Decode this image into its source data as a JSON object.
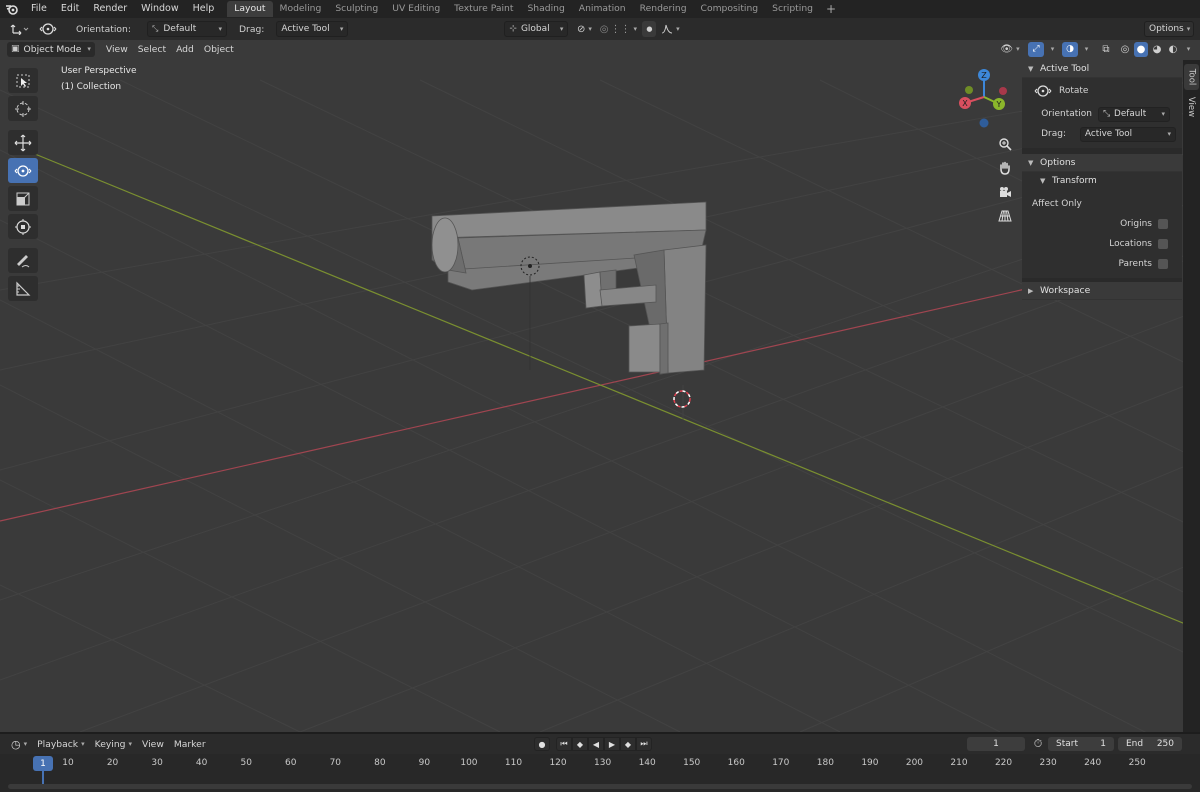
{
  "menubar": {
    "menus": [
      "File",
      "Edit",
      "Render",
      "Window",
      "Help"
    ],
    "workspaces": [
      "Layout",
      "Modeling",
      "Sculpting",
      "UV Editing",
      "Texture Paint",
      "Shading",
      "Animation",
      "Rendering",
      "Compositing",
      "Scripting"
    ],
    "active_workspace": "Layout",
    "add_workspace": "+"
  },
  "toolheader": {
    "orientation_label": "Orientation:",
    "orientation_value": "Default",
    "drag_label": "Drag:",
    "drag_value": "Active Tool",
    "transform_orientation": "Global",
    "options_label": "Options"
  },
  "viewport_header": {
    "mode": "Object Mode",
    "menus": [
      "View",
      "Select",
      "Add",
      "Object"
    ]
  },
  "viewport": {
    "perspective_label": "User Perspective",
    "collection_label": "(1) Collection",
    "gizmo_axes": [
      "X",
      "Y",
      "Z"
    ],
    "colors": {
      "x_axis": "#d84f5f",
      "y_axis": "#8bb62b",
      "z_axis": "#3d87d8",
      "accent": "#4772b3"
    }
  },
  "toolbar": {
    "tools": [
      "select-box-icon",
      "cursor-icon",
      "move-icon",
      "rotate-icon",
      "scale-icon",
      "transform-icon",
      "annotate-icon",
      "measure-icon"
    ],
    "active_tool": "rotate-icon"
  },
  "npanel": {
    "active_tool_header": "Active Tool",
    "tool_name": "Rotate",
    "orientation_label": "Orientation",
    "orientation_value": "Default",
    "drag_label": "Drag:",
    "drag_value": "Active Tool",
    "options_header": "Options",
    "transform_header": "Transform",
    "affect_only_label": "Affect Only",
    "origins_label": "Origins",
    "locations_label": "Locations",
    "parents_label": "Parents",
    "workspace_header": "Workspace",
    "tabs": [
      "Tool",
      "View"
    ]
  },
  "timeline_header": {
    "menus": [
      "Playback",
      "Keying",
      "View",
      "Marker"
    ],
    "current_frame": "1",
    "start_label": "Start",
    "start_value": "1",
    "end_label": "End",
    "end_value": "250"
  },
  "timeline": {
    "current_frame": "1",
    "ruler": [
      "10",
      "20",
      "30",
      "40",
      "50",
      "60",
      "70",
      "80",
      "90",
      "100",
      "110",
      "120",
      "130",
      "140",
      "150",
      "160",
      "170",
      "180",
      "190",
      "200",
      "210",
      "220",
      "230",
      "240",
      "250"
    ]
  }
}
